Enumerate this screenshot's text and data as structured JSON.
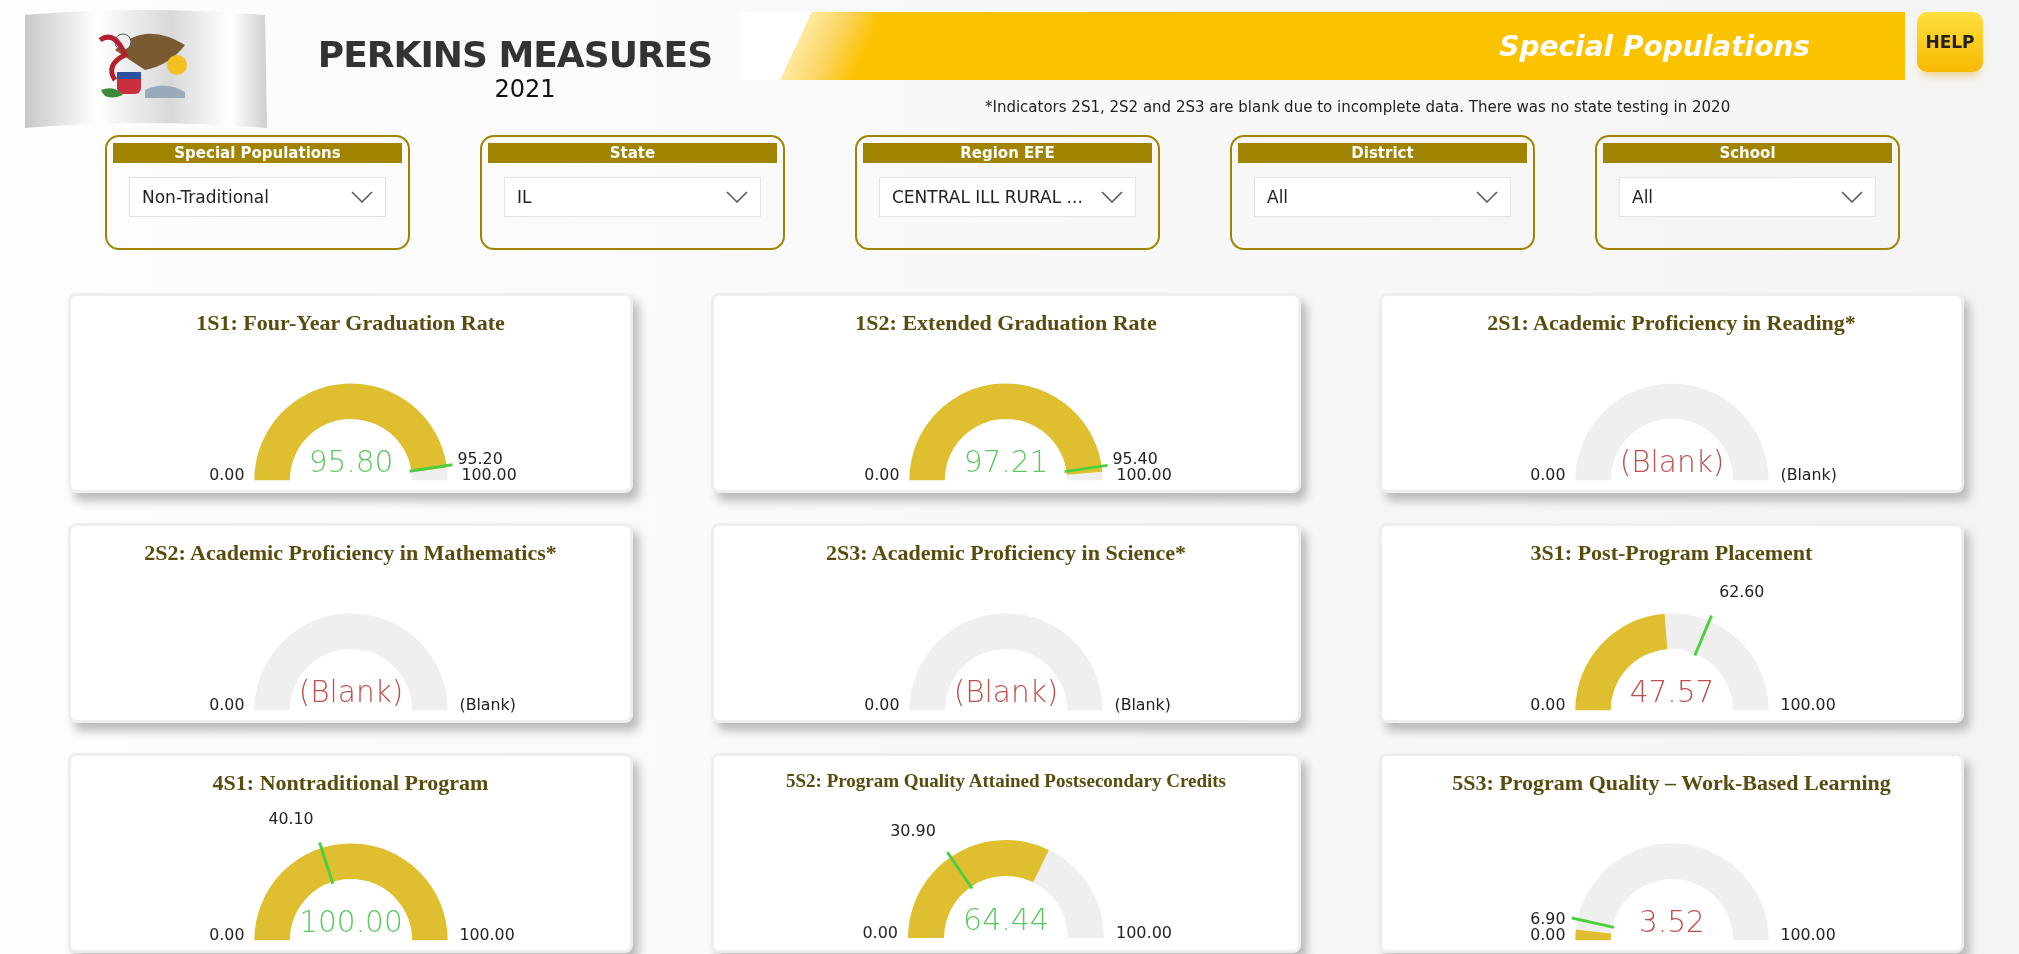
{
  "header": {
    "title": "PERKINS MEASURES",
    "year": "2021",
    "banner": "Special Populations",
    "help": "HELP",
    "note": "*Indicators 2S1, 2S2 and 2S3 are blank due to incomplete data. There was no state testing in 2020"
  },
  "filters": [
    {
      "label": "Special Populations",
      "value": "Non-Traditional"
    },
    {
      "label": "State",
      "value": "IL"
    },
    {
      "label": "Region EFE",
      "value": "CENTRAL ILL RURAL ..."
    },
    {
      "label": "District",
      "value": "All"
    },
    {
      "label": "School",
      "value": "All"
    }
  ],
  "gauges": [
    {
      "title": "1S1: Four-Year Graduation Rate",
      "value": "95.80",
      "target": "95.20",
      "min": "0.00",
      "max": "100.00"
    },
    {
      "title": "1S2: Extended Graduation Rate",
      "value": "97.21",
      "target": "95.40",
      "min": "0.00",
      "max": "100.00"
    },
    {
      "title": "2S1: Academic Proficiency in Reading*",
      "value": "(Blank)",
      "min": "0.00",
      "max": "(Blank)"
    },
    {
      "title": "2S2: Academic Proficiency in Mathematics*",
      "value": "(Blank)",
      "min": "0.00",
      "max": "(Blank)"
    },
    {
      "title": "2S3: Academic Proficiency in Science*",
      "value": "(Blank)",
      "min": "0.00",
      "max": "(Blank)"
    },
    {
      "title": "3S1: Post-Program Placement",
      "value": "47.57",
      "target": "62.60",
      "min": "0.00",
      "max": "100.00"
    },
    {
      "title": "4S1: Nontraditional Program",
      "value": "100.00",
      "target": "40.10",
      "min": "0.00",
      "max": "100.00"
    },
    {
      "title": "5S2: Program Quality Attained Postsecondary Credits",
      "value": "64.44",
      "target": "30.90",
      "min": "0.00",
      "max": "100.00"
    },
    {
      "title": "5S3: Program Quality – Work-Based Learning",
      "value": "3.52",
      "target": "6.90",
      "min": "0.00",
      "max": "100.00"
    }
  ]
}
